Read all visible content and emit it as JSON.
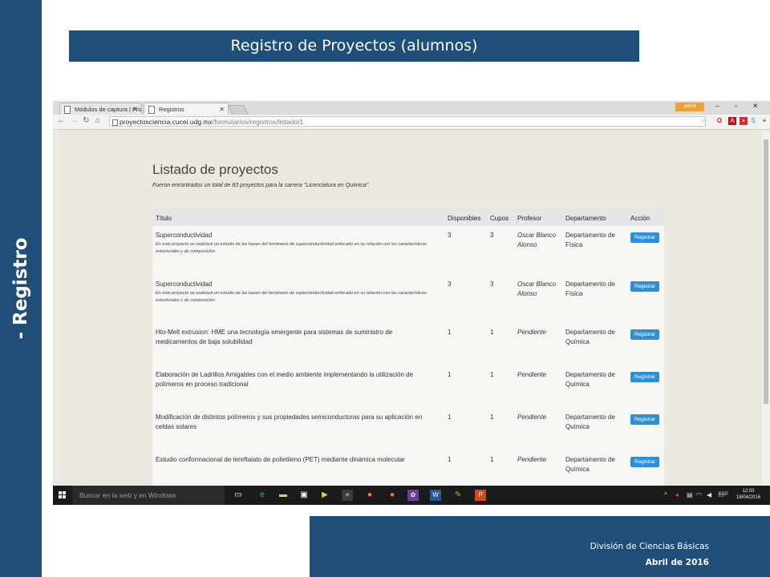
{
  "slide": {
    "side_label": "- Registro",
    "title": "Registro de Proyectos (alumnos)",
    "footer_org": "División de Ciencias Básicas",
    "footer_date": "Abril de 2016",
    "accent_color": "#1f4e79"
  },
  "browser": {
    "tabs": [
      {
        "label": "Módulos de captura | Pro",
        "active": false
      },
      {
        "label": "Registros",
        "active": true
      }
    ],
    "user_badge": "ardvfi",
    "url_host": "proyectosciencia.cucei.udg.mx",
    "url_path": "/formularios/registros/listado/1",
    "icons": [
      "back-arrow-icon",
      "forward-arrow-icon",
      "reload-icon",
      "home-icon",
      "star-icon",
      "opera-icon",
      "adobe-icon",
      "pdf-icon",
      "skype-icon",
      "menu-icon"
    ]
  },
  "page": {
    "title": "Listado de proyectos",
    "subtitle": "Fueron encontrados un total de 83 proyectos para la carrera \"Licenciatura en Química\".",
    "columns": [
      "Título",
      "Disponibles",
      "Cupos",
      "Profesor",
      "Departamento",
      "Acción"
    ],
    "rows": [
      {
        "title": "Superconductividad",
        "description": "En este proyecto se realizará un estudio de las bases del fenómeno de superconductividad enfocado en su relación con las características estucturales y de composición.",
        "available": "3",
        "slots": "3",
        "professor": "Oscar Blanco Alonso",
        "department": "Departamento de Física",
        "action": "Registrar"
      },
      {
        "title": "Superconductividad",
        "description": "En este proyecto se realizará un estudio de las bases del fenómeno de superconductividad enfocado en su relación con las características estucturales y de composición.",
        "available": "3",
        "slots": "3",
        "professor": "Oscar Blanco Alonso",
        "department": "Departamento de Física",
        "action": "Registrar"
      },
      {
        "title": "Hto-Melt extrusion: HME una tecnología emergente para sistemas de suministro de medicamentos de baja solubilidad",
        "description": "",
        "available": "1",
        "slots": "1",
        "professor": "Pendiente",
        "department": "Departamento de Química",
        "action": "Registrar"
      },
      {
        "title": "Elaboración de Ladrillos Amigables con el medio ambiente implementando la utilización de polímeros en proceso tradicional",
        "description": "",
        "available": "1",
        "slots": "1",
        "professor": "Pendiente",
        "department": "Departamento de Química",
        "action": "Registrar"
      },
      {
        "title": "Modificación de distintos polímeros y sus propiedades semiconductoras para su aplicación en celdas solares",
        "description": "",
        "available": "1",
        "slots": "1",
        "professor": "Pendiente",
        "department": "Departamento de Química",
        "action": "Registrar"
      },
      {
        "title": "Estudio conformacional de tereftalato de polietileno (PET) mediante dinámica molecular",
        "description": "",
        "available": "1",
        "slots": "1",
        "professor": "Pendiente",
        "department": "Departamento de Química",
        "action": "Registrar"
      }
    ]
  },
  "taskbar": {
    "search_placeholder": "Buscar en la web y en Windows",
    "language": "ESP",
    "time": "12:03",
    "date": "18/04/2016"
  }
}
